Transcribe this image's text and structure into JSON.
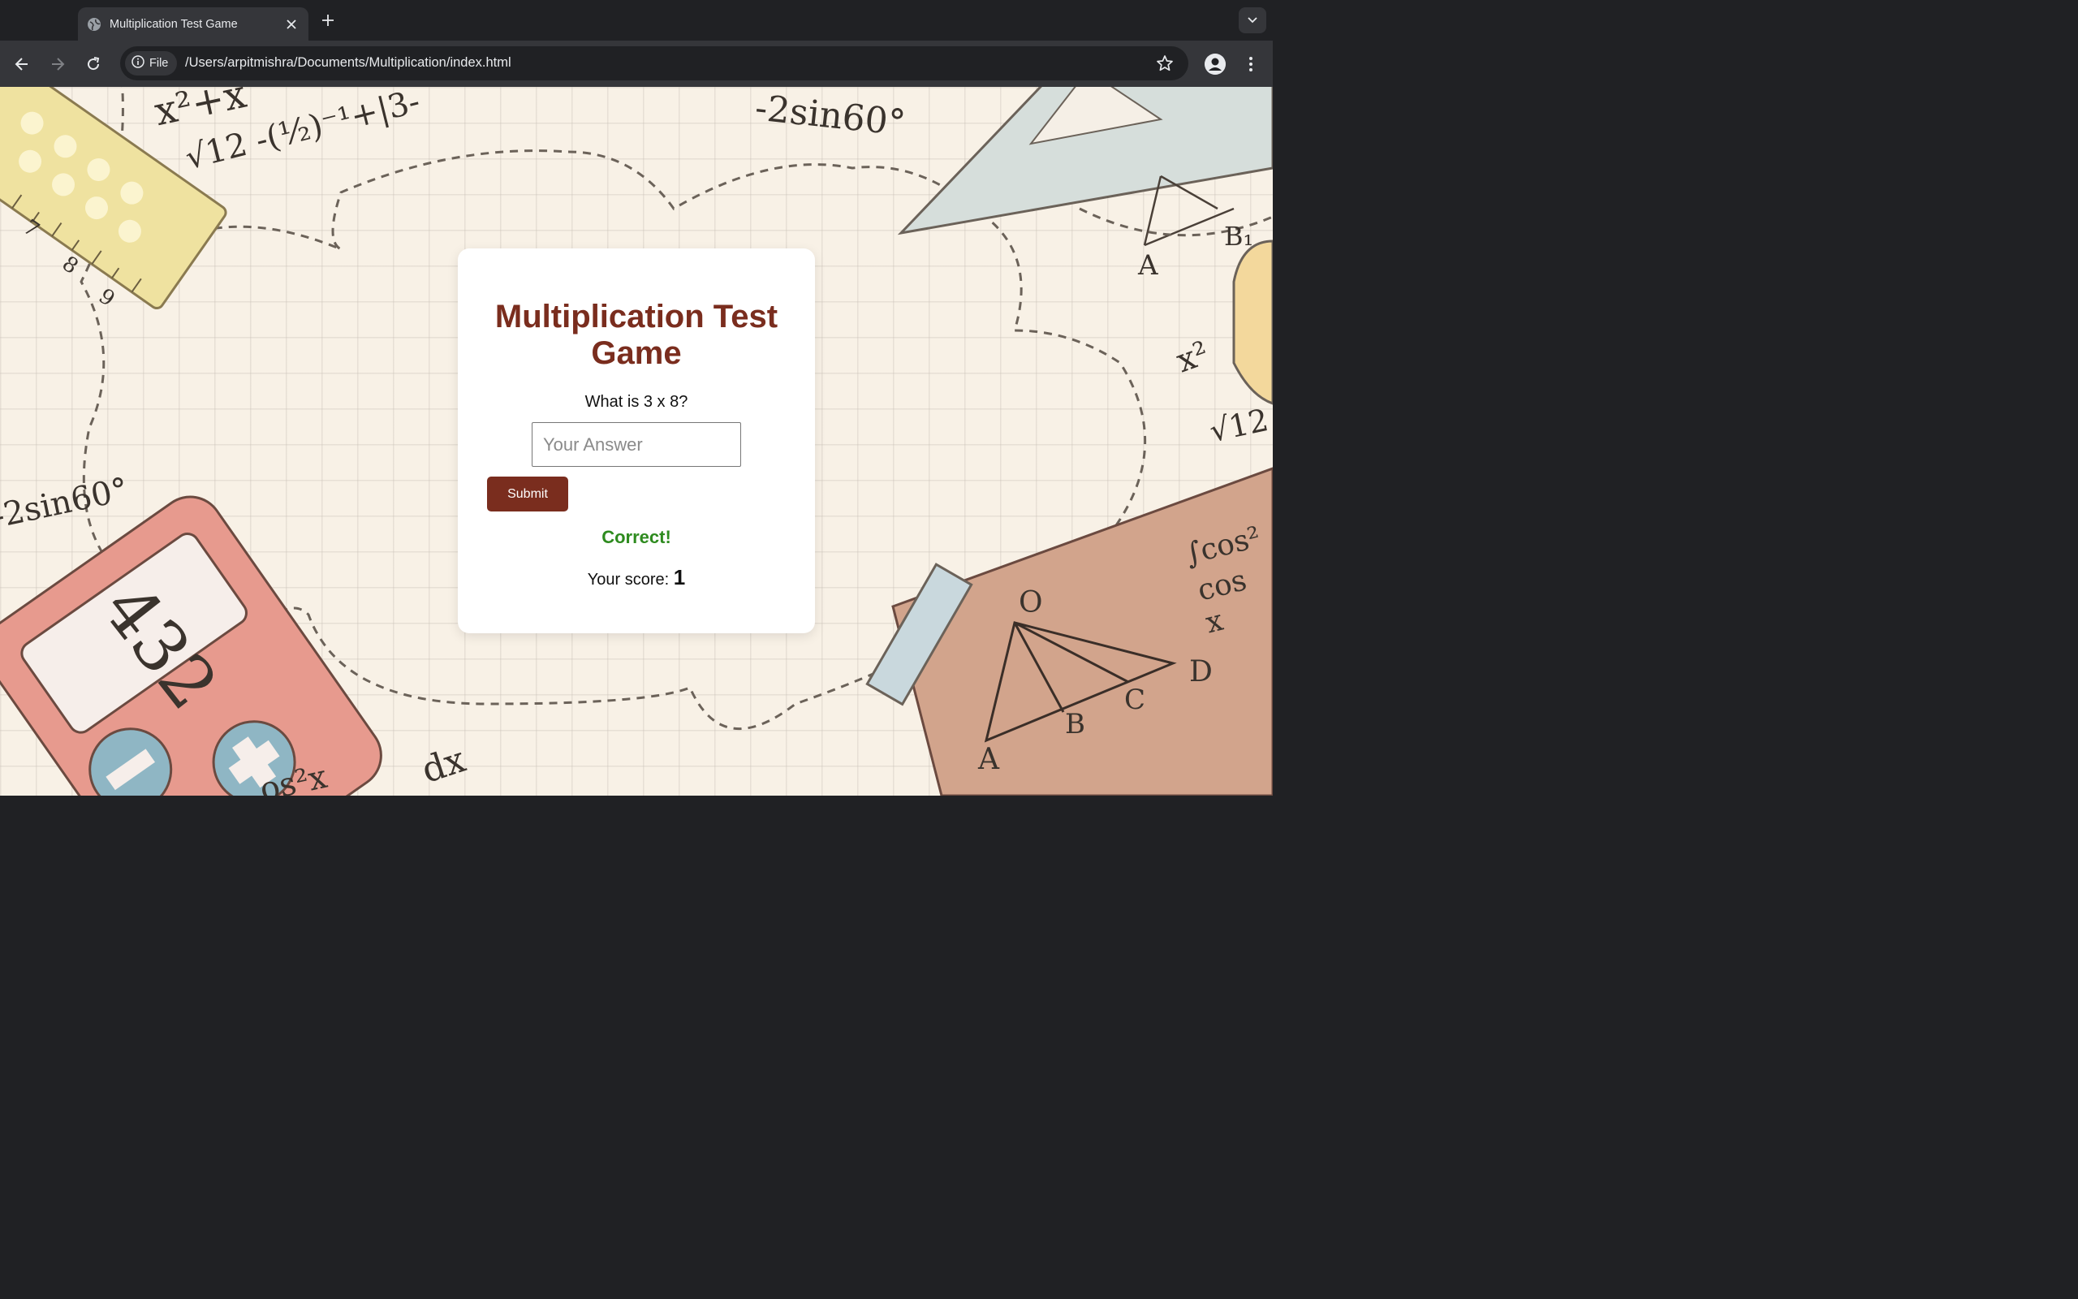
{
  "browser": {
    "tab_title": "Multiplication Test Game",
    "site_chip": "File",
    "url": "/Users/arpitmishra/Documents/Multiplication/index.html"
  },
  "game": {
    "title": "Multiplication Test Game",
    "question": "What is 3 x 8?",
    "answer_placeholder": "Your Answer",
    "submit_label": "Submit",
    "feedback": "Correct!",
    "score_label": "Your score:",
    "score_value": "1"
  },
  "background": {
    "formulas": [
      "x²+x",
      "-2sin60°",
      "√12 -(½)⁻¹+|3-",
      "-2sin60°",
      "432",
      "x²",
      "√12",
      "∫cos²",
      "cos x",
      "dx",
      "os²x"
    ],
    "triangle_labels": [
      "O",
      "D",
      "C",
      "B",
      "A",
      "A",
      "B₁"
    ],
    "ruler_numbers": [
      "7",
      "8",
      "9"
    ]
  },
  "colors": {
    "title": "#7a2d1e",
    "submit_bg": "#7a2d1e",
    "feedback": "#2e8b1f",
    "page_bg": "#f8f1e6"
  },
  "icons": [
    "globe-icon",
    "close-icon",
    "plus-icon",
    "chevron-down-icon",
    "back-arrow-icon",
    "forward-arrow-icon",
    "reload-icon",
    "info-icon",
    "star-icon",
    "profile-icon",
    "kebab-menu-icon"
  ]
}
